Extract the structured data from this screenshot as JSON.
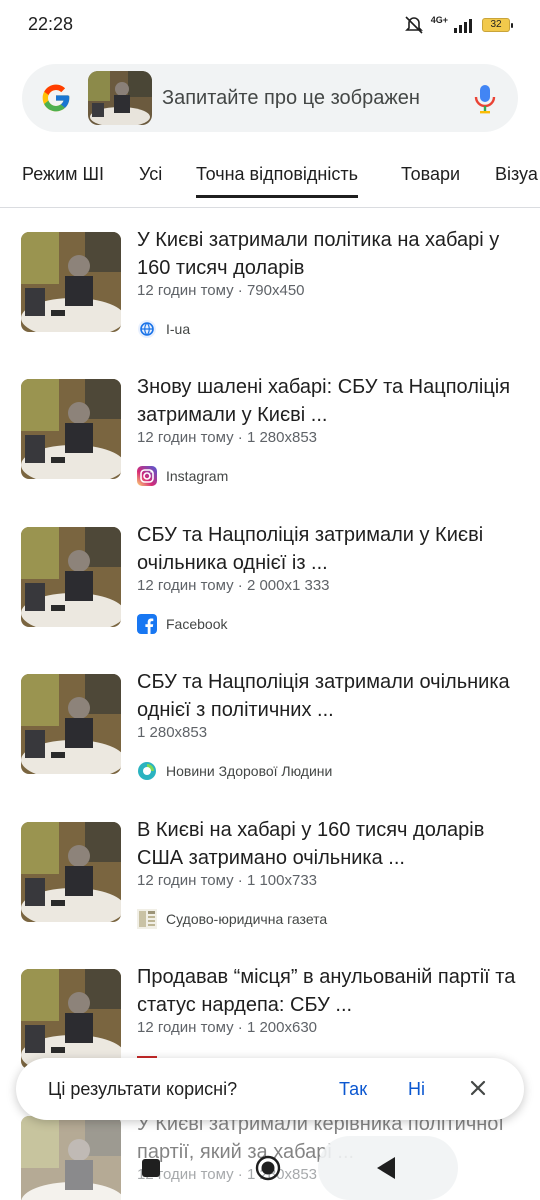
{
  "status_bar": {
    "time": "22:28",
    "network": "4G+",
    "battery": "32"
  },
  "search": {
    "placeholder": "Запитайте про це зображен"
  },
  "tabs": [
    "Режим ШІ",
    "Усі",
    "Точна відповідність",
    "Товари",
    "Візуа"
  ],
  "active_tab": "Точна відповідність",
  "results": [
    {
      "title": "У Києві затримали політика на хабарі у 160 тисяч доларів",
      "meta": "12 годин тому · 790x450",
      "source": "I-ua",
      "source_icon": "globe-icon"
    },
    {
      "title": "Знову шалені хабарі: СБУ та Нацполіція затримали у Києві ...",
      "meta": "12 годин тому · 1 280x853",
      "source": "Instagram",
      "source_icon": "instagram-icon"
    },
    {
      "title": "СБУ та Нацполіція затримали у Києві очільника однієї із ...",
      "meta": "12 годин тому · 2 000x1 333",
      "source": "Facebook",
      "source_icon": "facebook-icon"
    },
    {
      "title": "СБУ та Нацполіція затримали очільника однієї з політичних ...",
      "meta": "1 280x853",
      "source": "Новини Здорової Людини",
      "source_icon": "site-logo-icon"
    },
    {
      "title": "В Києві на хабарі у 160 тисяч доларів США затримано очільника ...",
      "meta": "12 годин тому · 1 100x733",
      "source": "Судово-юридична газета",
      "source_icon": "newspaper-icon"
    },
    {
      "title": "Продавав “місця” в анульованій партії та статус нардепа: СБУ ...",
      "meta": "12 годин тому · 1 200x630",
      "source": "",
      "source_icon": "flag-icon"
    },
    {
      "title": "У Києві затримали керівника політичної партії, який за хабарі ...",
      "meta": "12 годин тому · 1 280x853",
      "source": "",
      "source_icon": ""
    }
  ],
  "feedback": {
    "question": "Ці результати корисні?",
    "yes": "Так",
    "no": "Ні"
  },
  "colors": {
    "link_blue": "#0b57d0",
    "text": "#1f1f1f",
    "meta": "#5f6368",
    "search_bg": "#f1f3f4"
  }
}
